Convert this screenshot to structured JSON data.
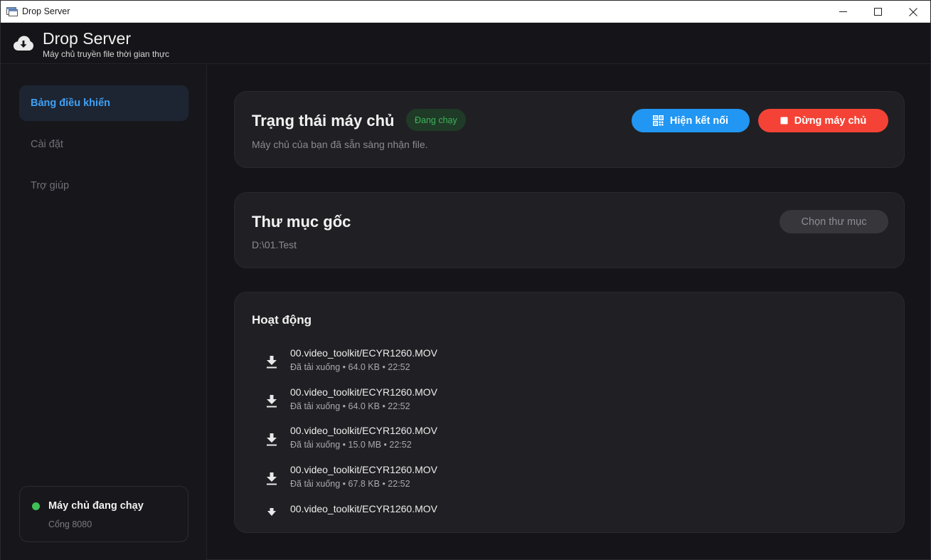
{
  "window": {
    "title": "Drop Server",
    "controls": [
      "minimize-icon",
      "maximize-icon",
      "close-icon"
    ]
  },
  "header": {
    "title": "Drop Server",
    "subtitle": "Máy chủ truyền file thời gian thực",
    "icon": "cloud-download-icon"
  },
  "sidebar": {
    "items": [
      {
        "label": "Bảng điều khiển",
        "active": true
      },
      {
        "label": "Cài đặt",
        "active": false
      },
      {
        "label": "Trợ giúp",
        "active": false
      }
    ],
    "status": {
      "title": "Máy chủ đang chạy",
      "port": "Cổng 8080",
      "color": "#3fbf55"
    }
  },
  "server_card": {
    "title": "Trạng thái máy chủ",
    "badge": "Đang chạy",
    "subtitle": "Máy chủ của bạn đã sẵn sàng nhận file.",
    "show_connection_label": "Hiện kết nối",
    "stop_label": "Dừng máy chủ"
  },
  "folder_card": {
    "title": "Thư mục gốc",
    "path": "D:\\01.Test",
    "choose_label": "Chọn thư mục"
  },
  "activity": {
    "title": "Hoạt động",
    "items": [
      {
        "file": "00.video_toolkit/ECYR1260.MOV",
        "meta": "Đã tải xuống • 64.0 KB • 22:52"
      },
      {
        "file": "00.video_toolkit/ECYR1260.MOV",
        "meta": "Đã tải xuống • 64.0 KB • 22:52"
      },
      {
        "file": "00.video_toolkit/ECYR1260.MOV",
        "meta": "Đã tải xuống • 15.0 MB • 22:52"
      },
      {
        "file": "00.video_toolkit/ECYR1260.MOV",
        "meta": "Đã tải xuống • 67.8 KB • 22:52"
      },
      {
        "file": "00.video_toolkit/ECYR1260.MOV",
        "meta": ""
      }
    ]
  },
  "colors": {
    "accent_blue": "#2196f3",
    "danger_red": "#f44336",
    "running_green": "#3eb35a"
  }
}
